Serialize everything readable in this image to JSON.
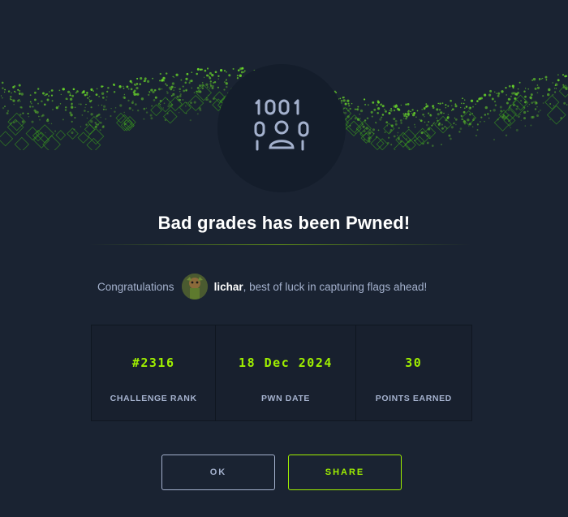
{
  "modal": {
    "badge_icon": "binary-user-icon",
    "title": "Bad grades has been Pwned!",
    "congrats_prefix": "Congratulations",
    "username": "lichar",
    "congrats_suffix": ", best of luck in capturing flags ahead!",
    "stats": [
      {
        "value": "#2316",
        "label": "CHALLENGE RANK"
      },
      {
        "value": "18 Dec 2024",
        "label": "PWN DATE"
      },
      {
        "value": "30",
        "label": "POINTS EARNED"
      }
    ],
    "buttons": {
      "ok": "OK",
      "share": "SHARE"
    }
  },
  "colors": {
    "background": "#1a2332",
    "accent": "#9fef00",
    "muted_text": "#a4b1cd",
    "badge_bg": "#141d2b"
  }
}
